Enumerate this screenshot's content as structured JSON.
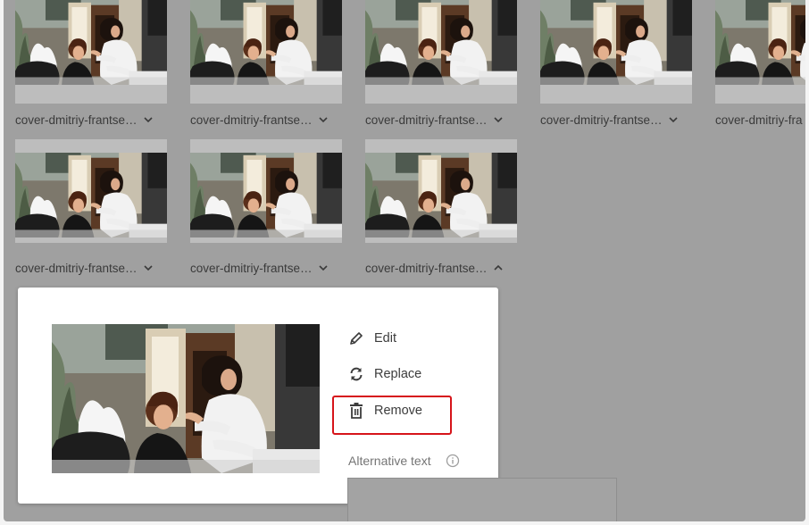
{
  "gallery": {
    "items": [
      {
        "caption": "cover-dmitriy-frantse…",
        "expanded": false
      },
      {
        "caption": "cover-dmitriy-frantse…",
        "expanded": false
      },
      {
        "caption": "cover-dmitriy-frantse…",
        "expanded": false
      },
      {
        "caption": "cover-dmitriy-frantse…",
        "expanded": false
      },
      {
        "caption": "cover-dmitriy-fra",
        "expanded": false
      },
      {
        "caption": "cover-dmitriy-frantse…",
        "expanded": false
      },
      {
        "caption": "cover-dmitriy-frantse…",
        "expanded": false
      },
      {
        "caption": "cover-dmitriy-frantse…",
        "expanded": true
      }
    ]
  },
  "image_panel": {
    "actions": {
      "edit": "Edit",
      "replace": "Replace",
      "remove": "Remove"
    },
    "alt_text_label": "Alternative text",
    "alt_text_value": "",
    "icons": {
      "edit": "pencil-icon",
      "replace": "refresh-icon",
      "remove": "trash-icon",
      "info": "info-icon",
      "collapsed": "chevron-down-icon",
      "expanded": "chevron-up-icon"
    }
  },
  "colors": {
    "overlay": "#a0a0a0",
    "highlight": "#d6141a"
  }
}
